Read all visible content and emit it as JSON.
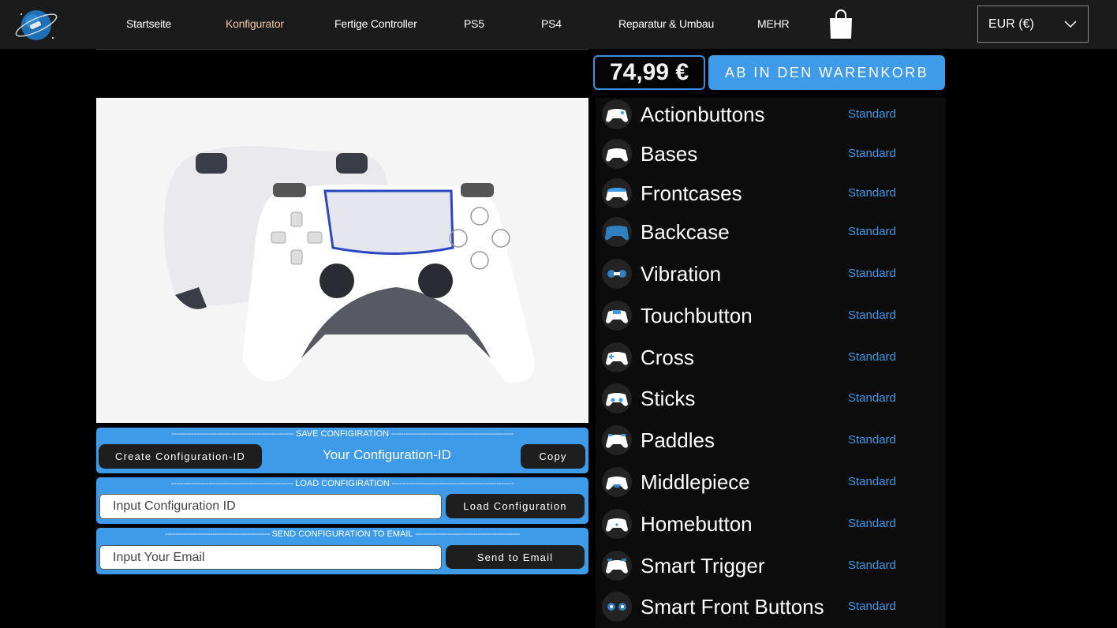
{
  "nav": {
    "items": [
      "Startseite",
      "Konfigurator",
      "Fertige Controller",
      "PS5",
      "PS4",
      "Reparatur & Umbau",
      "MEHR"
    ],
    "active_index": 1,
    "currency": "EUR (€)"
  },
  "purchase": {
    "price": "74,99 €",
    "cart_label": "AB IN DEN WARENKORB"
  },
  "save_config": {
    "title": "SAVE CONFIGIRATION",
    "create_label": "Create Configuration-ID",
    "id_text": "Your Configuration-ID",
    "copy_label": "Copy"
  },
  "load_config": {
    "title": "LOAD CONFIGIRATION",
    "input_placeholder": "Input Configuration ID",
    "button_label": "Load Configuration"
  },
  "email_config": {
    "title": "SEND CONFIGURATION TO EMAIL",
    "input_placeholder": "Input Your Email",
    "button_label": "Send to Email"
  },
  "options": [
    {
      "label": "Actionbuttons",
      "value": "Standard"
    },
    {
      "label": "Bases",
      "value": "Standard"
    },
    {
      "label": "Frontcases",
      "value": "Standard"
    },
    {
      "label": "Backcase",
      "value": "Standard"
    },
    {
      "label": "Vibration",
      "value": "Standard"
    },
    {
      "label": "Touchbutton",
      "value": "Standard"
    },
    {
      "label": "Cross",
      "value": "Standard"
    },
    {
      "label": "Sticks",
      "value": "Standard"
    },
    {
      "label": "Paddles",
      "value": "Standard"
    },
    {
      "label": "Middlepiece",
      "value": "Standard"
    },
    {
      "label": "Homebutton",
      "value": "Standard"
    },
    {
      "label": "Smart Trigger",
      "value": "Standard"
    },
    {
      "label": "Smart Front Buttons",
      "value": "Standard"
    }
  ],
  "colors": {
    "accent": "#3d9be9",
    "topbar": "#1b1b1b",
    "active_nav": "#f3c6a6"
  }
}
